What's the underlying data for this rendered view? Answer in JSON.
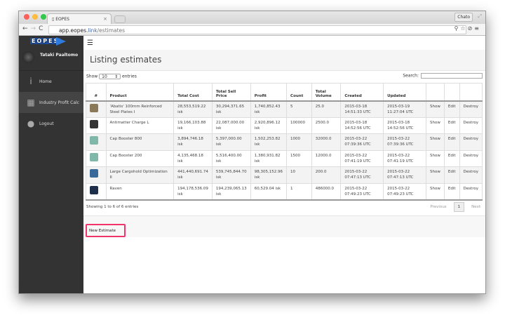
{
  "browser": {
    "tab_title": "EOPES",
    "user": "Chato",
    "url_host": "app.eopes.",
    "url_tld": "link",
    "url_path": "/estimates"
  },
  "sidebar": {
    "logo": "EOPES",
    "user_name": "Tataki Paaltomo",
    "items": [
      {
        "label": "Home",
        "icon": "info-icon"
      },
      {
        "label": "Industry Profit Calc",
        "icon": "calculator-icon"
      },
      {
        "label": "Logout",
        "icon": "user-icon"
      }
    ]
  },
  "page": {
    "title": "Listing estimates",
    "show_label": "Show",
    "show_value": "10",
    "entries_label": "entries",
    "search_label": "Search:",
    "info": "Showing 1 to 6 of 6 entries",
    "previous": "Previous",
    "page": "1",
    "next": "Next",
    "new_estimate": "New Estimate"
  },
  "table": {
    "headers": [
      "#",
      "Product",
      "Total Cost",
      "Total Sell Price",
      "Profit",
      "Count",
      "Total Volume",
      "Created",
      "Updated",
      "",
      "",
      ""
    ],
    "rows": [
      {
        "product": "'Abatis' 100mm Reinforced Steel Plates I",
        "cost": "28,553,519.22 isk",
        "sell": "30,294,371.65 isk",
        "profit": "1,740,852.43 isk",
        "count": "5",
        "volume": "25.0",
        "created": "2015-03-18 14:51:33 UTC",
        "updated": "2015-03-19 11:27:04 UTC",
        "color": "#8a7a5a"
      },
      {
        "product": "Antimatter Charge L",
        "cost": "19,166,103.88 isk",
        "sell": "22,087,000.00 isk",
        "profit": "2,920,896.12 isk",
        "count": "100000",
        "volume": "2500.0",
        "created": "2015-03-18 14:52:56 UTC",
        "updated": "2015-03-18 14:52:56 UTC",
        "color": "#333333"
      },
      {
        "product": "Cap Booster 800",
        "cost": "3,894,746.18 isk",
        "sell": "5,397,000.00 isk",
        "profit": "1,502,253.82 isk",
        "count": "1000",
        "volume": "32000.0",
        "created": "2015-03-22 07:39:36 UTC",
        "updated": "2015-03-22 07:39:36 UTC",
        "color": "#7fb8a8"
      },
      {
        "product": "Cap Booster 200",
        "cost": "4,135,468.18 isk",
        "sell": "5,516,400.00 isk",
        "profit": "1,380,931.82 isk",
        "count": "1500",
        "volume": "12000.0",
        "created": "2015-03-22 07:41:19 UTC",
        "updated": "2015-03-22 07:41:19 UTC",
        "color": "#7fb8a8"
      },
      {
        "product": "Large Cargohold Optimization II",
        "cost": "441,440,691.74 isk",
        "sell": "539,745,844.70 isk",
        "profit": "98,305,152.96 isk",
        "count": "10",
        "volume": "200.0",
        "created": "2015-03-22 07:47:13 UTC",
        "updated": "2015-03-22 07:47:13 UTC",
        "color": "#3a6a9a"
      },
      {
        "product": "Raven",
        "cost": "194,178,536.09 isk",
        "sell": "194,239,065.13 isk",
        "profit": "60,529.04 isk",
        "count": "1",
        "volume": "486000.0",
        "created": "2015-03-22 07:49:23 UTC",
        "updated": "2015-03-22 07:49:23 UTC",
        "color": "#1d2f4a"
      }
    ],
    "actions": [
      "Show",
      "Edit",
      "Destroy"
    ]
  },
  "colors": {
    "sidebar": "#333333",
    "highlight": "#f0356b"
  }
}
